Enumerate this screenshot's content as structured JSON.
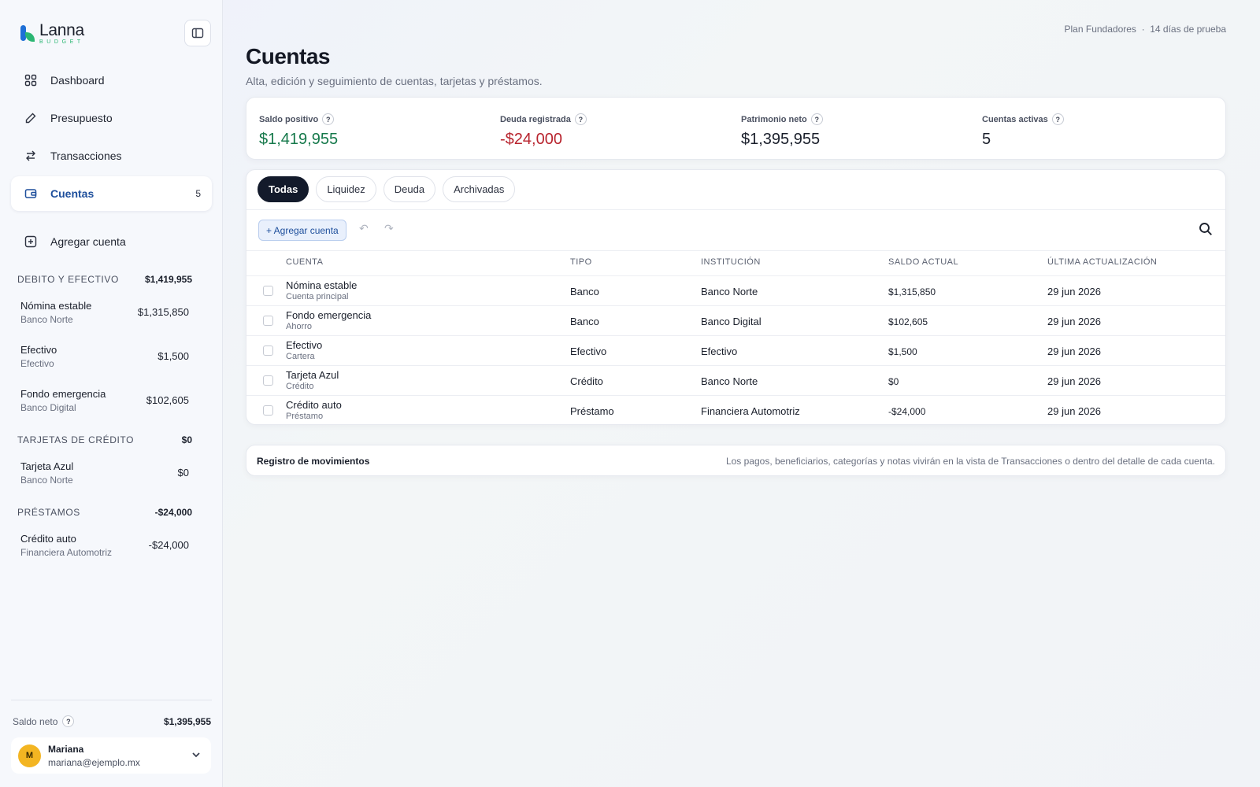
{
  "app": {
    "name": "Lanna",
    "sub": "BUDGET",
    "plan": "Plan Fundadores  ·  14 días de prueba"
  },
  "nav": {
    "dashboard": "Dashboard",
    "budget": "Presupuesto",
    "transactions": "Transacciones",
    "accounts": "Cuentas",
    "accounts_count": "5",
    "add_account": "Agregar cuenta"
  },
  "sidebar_groups": [
    {
      "title": "DEBITO Y EFECTIVO",
      "total": "$1,419,955",
      "items": [
        {
          "name": "Nómina estable",
          "inst": "Banco Norte",
          "amount": "$1,315,850"
        },
        {
          "name": "Efectivo",
          "inst": "Efectivo",
          "amount": "$1,500"
        },
        {
          "name": "Fondo emergencia",
          "inst": "Banco Digital",
          "amount": "$102,605"
        }
      ]
    },
    {
      "title": "TARJETAS DE CRÉDITO",
      "total": "$0",
      "items": [
        {
          "name": "Tarjeta Azul",
          "inst": "Banco Norte",
          "amount": "$0"
        }
      ]
    },
    {
      "title": "PRÉSTAMOS",
      "total": "-$24,000",
      "items": [
        {
          "name": "Crédito auto",
          "inst": "Financiera Automotriz",
          "amount": "-$24,000"
        }
      ]
    }
  ],
  "sidebar_footer": {
    "net_label": "Saldo neto",
    "net_value": "$1,395,955",
    "qmark": "?"
  },
  "user": {
    "initial": "M",
    "name": "Mariana",
    "email": "mariana@ejemplo.mx"
  },
  "page": {
    "title": "Cuentas",
    "subtitle": "Alta, edición y seguimiento de cuentas, tarjetas y préstamos."
  },
  "stats": [
    {
      "label": "Saldo positivo",
      "value": "$1,419,955",
      "tone": "pos"
    },
    {
      "label": "Deuda registrada",
      "value": "-$24,000",
      "tone": "neg"
    },
    {
      "label": "Patrimonio neto",
      "value": "$1,395,955",
      "tone": "neu"
    },
    {
      "label": "Cuentas activas",
      "value": "5",
      "tone": "neu"
    }
  ],
  "tabs": [
    "Todas",
    "Liquidez",
    "Deuda",
    "Archivadas"
  ],
  "toolbar": {
    "add_label": "+ Agregar cuenta",
    "undo": "↶",
    "redo": "↷"
  },
  "table": {
    "headers": [
      "CUENTA",
      "TIPO",
      "INSTITUCIÓN",
      "SALDO ACTUAL",
      "ÚLTIMA ACTUALIZACIÓN"
    ],
    "rows": [
      {
        "name": "Nómina estable",
        "sub": "Cuenta principal",
        "type": "Banco",
        "inst": "Banco Norte",
        "balance": "$1,315,850",
        "tone": "pos",
        "updated": "29 jun 2026"
      },
      {
        "name": "Fondo emergencia",
        "sub": "Ahorro",
        "type": "Banco",
        "inst": "Banco Digital",
        "balance": "$102,605",
        "tone": "pos",
        "updated": "29 jun 2026"
      },
      {
        "name": "Efectivo",
        "sub": "Cartera",
        "type": "Efectivo",
        "inst": "Efectivo",
        "balance": "$1,500",
        "tone": "pos",
        "updated": "29 jun 2026"
      },
      {
        "name": "Tarjeta Azul",
        "sub": "Crédito",
        "type": "Crédito",
        "inst": "Banco Norte",
        "balance": "$0",
        "tone": "pos",
        "updated": "29 jun 2026"
      },
      {
        "name": "Crédito auto",
        "sub": "Préstamo",
        "type": "Préstamo",
        "inst": "Financiera Automotriz",
        "balance": "-$24,000",
        "tone": "neg",
        "updated": "29 jun 2026"
      }
    ]
  },
  "register": {
    "title": "Registro de movimientos",
    "note": "Los pagos, beneficiarios, categorías y notas vivirán en la vista de Transacciones o dentro del detalle de cada cuenta."
  },
  "colors": {
    "accent": "#1e4f9c",
    "positive": "#16794b",
    "negative": "#b8242e",
    "tab_active": "#131a2b"
  },
  "icons": {
    "collapse": "sidebar-toggle-icon",
    "dashboard": "grid-icon",
    "budget": "pencil-icon",
    "transactions": "swap-arrows-icon",
    "accounts": "wallet-icon",
    "add_account": "plus-square-icon",
    "search": "search-icon",
    "user_menu": "chevron-down-icon"
  }
}
